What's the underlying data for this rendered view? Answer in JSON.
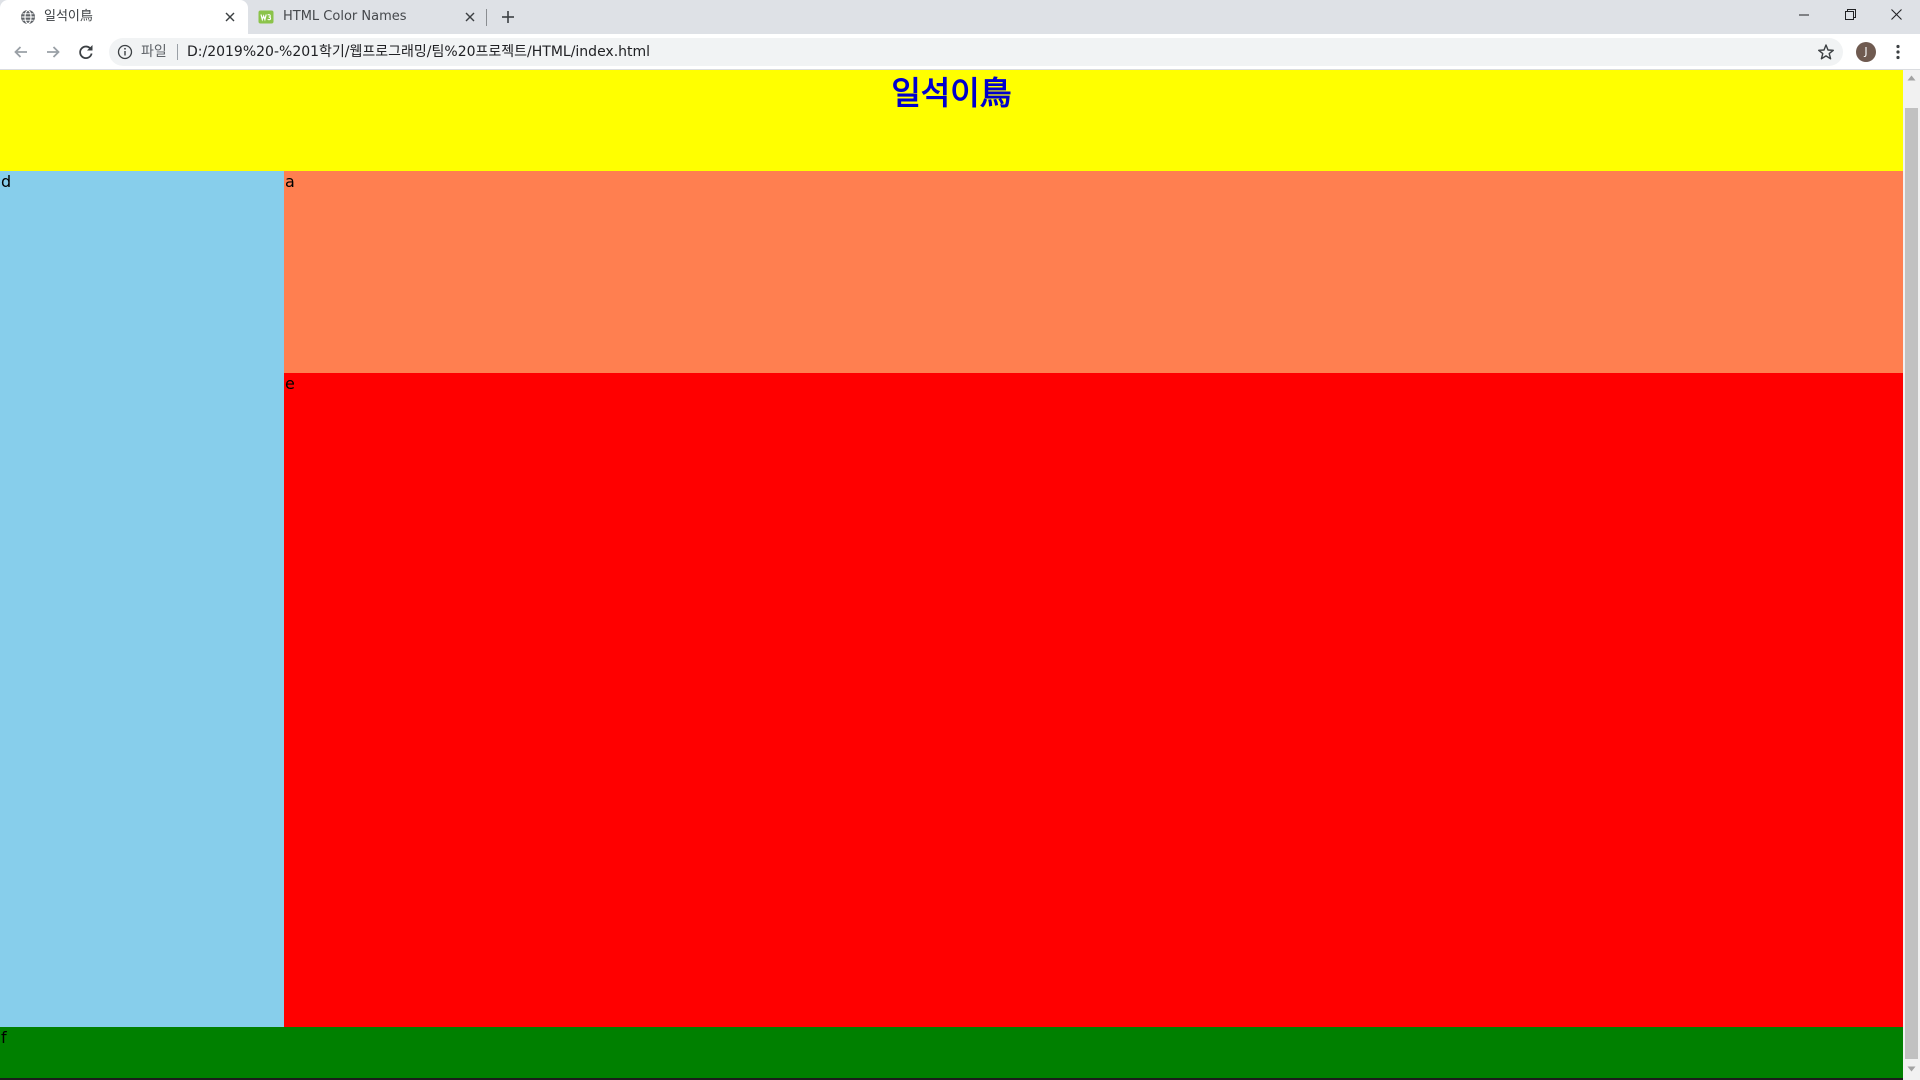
{
  "browser": {
    "tabs": [
      {
        "title": "일석이鳥",
        "icon": "globe-icon",
        "active": true
      },
      {
        "title": "HTML Color Names",
        "icon": "w3schools-icon",
        "active": false
      }
    ],
    "omnibox": {
      "scheme_label": "파일",
      "url": "D:/2019%20-%201학기/웹프로그래밍/팀%20프로젝트/HTML/index.html"
    },
    "profile": {
      "initial": "J"
    }
  },
  "page": {
    "header": {
      "title": "일석이鳥"
    },
    "sidebar": {
      "text": "d"
    },
    "top_section": {
      "text": "a"
    },
    "main_section": {
      "text": "e"
    },
    "footer": {
      "text": "f"
    }
  },
  "colors": {
    "header": "#ffff00",
    "title": "#0000cd",
    "sidebar": "#87ceeb",
    "top_section": "#ff7f50",
    "main_section": "#ff0000",
    "footer": "#008000"
  }
}
